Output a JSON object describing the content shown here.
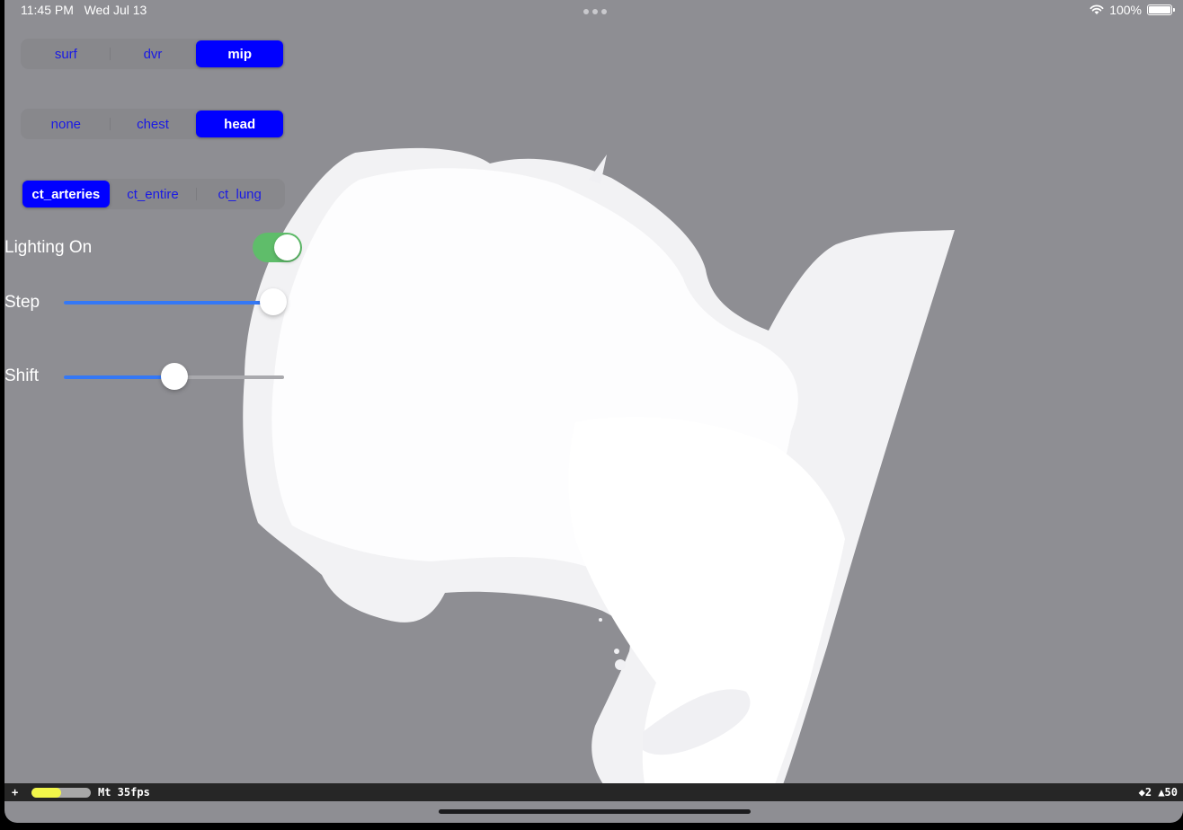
{
  "status_bar": {
    "time": "11:45 PM",
    "date": "Wed Jul 13",
    "battery": "100%"
  },
  "render_mode": {
    "options": [
      "surf",
      "dvr",
      "mip"
    ],
    "selected": "mip"
  },
  "preset": {
    "options": [
      "none",
      "chest",
      "head"
    ],
    "selected": "head"
  },
  "dataset": {
    "options": [
      "ct_arteries",
      "ct_entire",
      "ct_lung"
    ],
    "selected": "ct_arteries"
  },
  "lighting": {
    "label": "Lighting On",
    "on": true
  },
  "step": {
    "label": "Step",
    "value": 0.95
  },
  "shift": {
    "label": "Shift",
    "value": 0.5
  },
  "perf_hud": {
    "plus": "+",
    "fps": "Mt 35fps",
    "stats": "◆2 ▲50",
    "load": 0.5
  },
  "colors": {
    "accent": "#0000ff",
    "toggle_on": "#5fbd6a",
    "slider_fill": "#3478f6",
    "background": "#8e8e93",
    "volume": "#ffffff"
  }
}
